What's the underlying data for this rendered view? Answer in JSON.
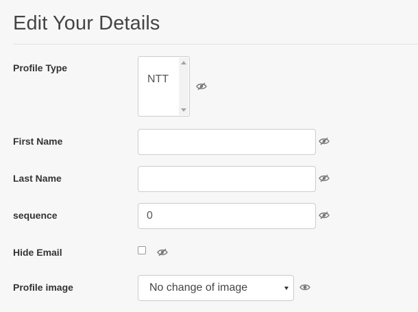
{
  "page": {
    "title": "Edit Your Details"
  },
  "form": {
    "profile_type": {
      "label": "Profile Type",
      "options": [
        "NTT"
      ]
    },
    "first_name": {
      "label": "First Name",
      "value": ""
    },
    "last_name": {
      "label": "Last Name",
      "value": ""
    },
    "sequence": {
      "label": "sequence",
      "value": "0"
    },
    "hide_email": {
      "label": "Hide Email",
      "checked": false
    },
    "profile_image": {
      "label": "Profile image",
      "selected": "No change of image"
    }
  },
  "icons": {
    "visibility_hidden": "eye-slash-icon",
    "visibility_shown": "eye-icon"
  },
  "colors": {
    "background": "#f7f7f7",
    "border": "#cccccc",
    "text": "#333333"
  }
}
